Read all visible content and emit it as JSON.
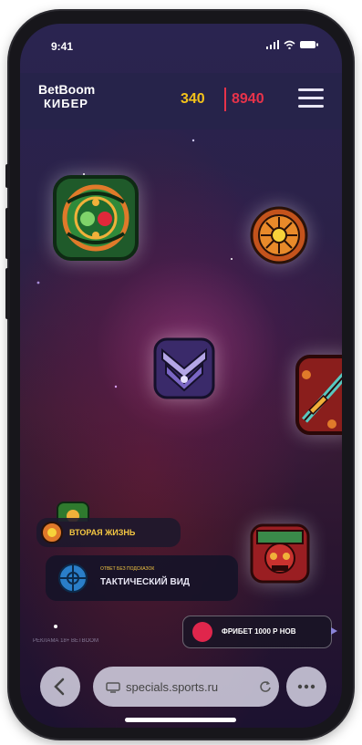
{
  "status_bar": {
    "time": "9:41"
  },
  "header": {
    "logo_line1": "BetBoom",
    "logo_line2": "КИБЕР",
    "score_yellow": "340",
    "score_red": "8940"
  },
  "tiles": [
    {
      "name": "green-mosaic-tile"
    },
    {
      "name": "orange-sun-medallion"
    },
    {
      "name": "purple-hero-tile"
    },
    {
      "name": "red-sword-tile"
    },
    {
      "name": "red-skull-tile"
    }
  ],
  "powerups": {
    "second_life": {
      "label": "ВТОРАЯ ЖИЗНЬ"
    },
    "tactical": {
      "small": "ОТВЕТ БЕЗ ПОДСКАЗОК",
      "title": "ТАКТИЧЕСКИЙ ВИД"
    }
  },
  "footer": {
    "note": "РЕКЛАМА 18+ BETBOOM",
    "bet_button": "ФРИБЕТ 1000 Р НОВ"
  },
  "browser": {
    "url": "specials.sports.ru"
  },
  "colors": {
    "accent_yellow": "#f3c21b",
    "accent_red": "#e8334a",
    "header_bg": "#26244a"
  }
}
